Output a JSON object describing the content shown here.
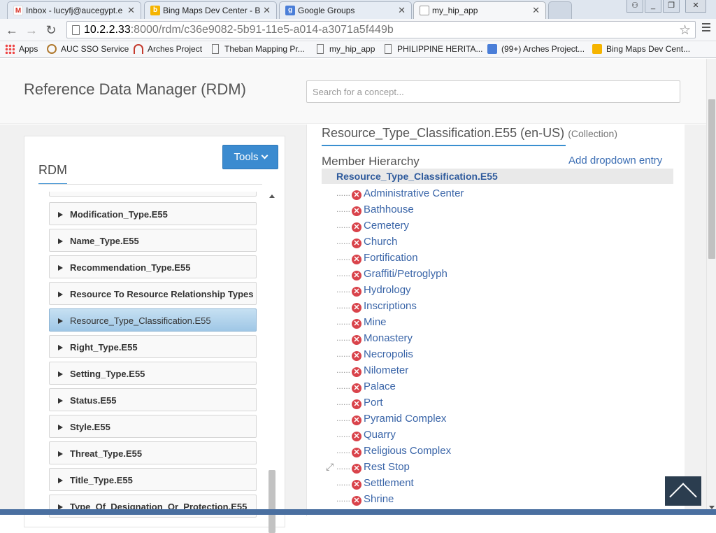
{
  "browser": {
    "tabs": [
      {
        "label": "Inbox - lucyfj@aucegypt.e",
        "icon": "gmail-icon",
        "color": "#d93025"
      },
      {
        "label": "Bing Maps Dev Center - B",
        "icon": "bing-icon",
        "color": "#f5b400"
      },
      {
        "label": "Google Groups",
        "icon": "google-groups-icon",
        "color": "#4a7ed8"
      },
      {
        "label": "my_hip_app",
        "icon": "page-icon",
        "color": "#999999",
        "active": true
      }
    ],
    "url_host": "10.2.2.33",
    "url_path": ":8000/rdm/c36e9082-5b91-11e5-a014-a3071a5f449b",
    "bookmarks": [
      {
        "label": "Apps",
        "icon": "apps-grid-icon"
      },
      {
        "label": "AUC SSO Service",
        "icon": "auc-icon"
      },
      {
        "label": "Arches Project",
        "icon": "arches-icon"
      },
      {
        "label": "Theban Mapping Pr...",
        "icon": "page-icon"
      },
      {
        "label": "my_hip_app",
        "icon": "page-icon"
      },
      {
        "label": "PHILIPPINE HERITA...",
        "icon": "page-icon"
      },
      {
        "label": "(99+) Arches Project...",
        "icon": "google-groups-icon"
      },
      {
        "label": "Bing Maps Dev Cent...",
        "icon": "bing-icon"
      }
    ]
  },
  "app": {
    "title": "Reference Data Manager (RDM)",
    "search_placeholder": "Search for a concept...",
    "accent": "#3b8bd0"
  },
  "left": {
    "title": "RDM",
    "tools_label": "Tools",
    "items": [
      {
        "label": "Modification_Type.E55"
      },
      {
        "label": "Name_Type.E55"
      },
      {
        "label": "Recommendation_Type.E55"
      },
      {
        "label": "Resource To Resource Relationship Types"
      },
      {
        "label": "Resource_Type_Classification.E55",
        "selected": true
      },
      {
        "label": "Right_Type.E55"
      },
      {
        "label": "Setting_Type.E55"
      },
      {
        "label": "Status.E55"
      },
      {
        "label": "Style.E55"
      },
      {
        "label": "Threat_Type.E55"
      },
      {
        "label": "Title_Type.E55"
      },
      {
        "label": "Type_Of_Designation_Or_Protection.E55"
      }
    ]
  },
  "right": {
    "heading": "Resource_Type_Classification.E55 (en-US)",
    "heading_suffix": "(Collection)",
    "subheading": "Member Hierarchy",
    "add_entry": "Add dropdown entry",
    "root": "Resource_Type_Classification.E55",
    "dots": "......",
    "members": [
      "Administrative Center",
      "Bathhouse",
      "Cemetery",
      "Church",
      "Fortification",
      "Graffiti/Petroglyph",
      "Hydrology",
      "Inscriptions",
      "Mine",
      "Monastery",
      "Necropolis",
      "Nilometer",
      "Palace",
      "Port",
      "Pyramid Complex",
      "Quarry",
      "Religious Complex",
      "Rest Stop",
      "Settlement",
      "Shrine"
    ]
  }
}
